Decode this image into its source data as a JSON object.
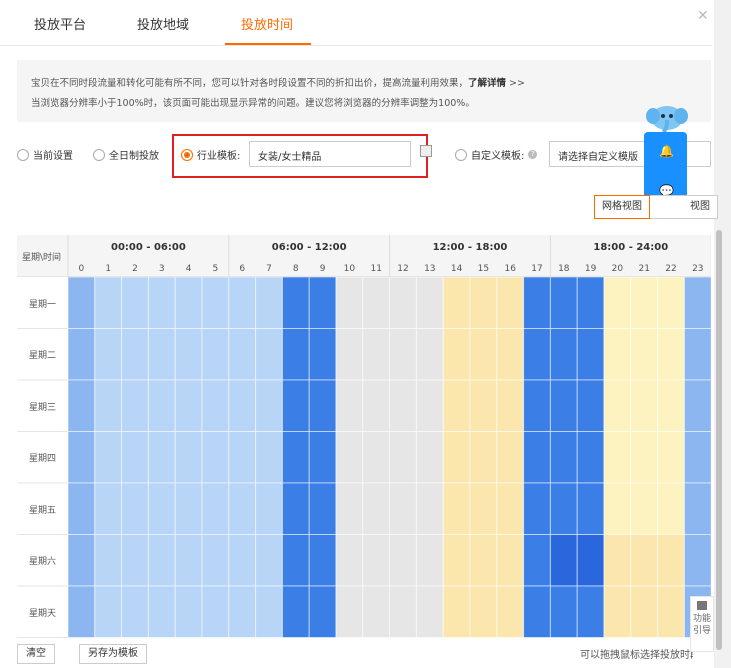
{
  "tabs": [
    {
      "label": "投放平台",
      "active": false
    },
    {
      "label": "投放地域",
      "active": false
    },
    {
      "label": "投放时间",
      "active": true
    }
  ],
  "notice": {
    "line1": "宝贝在不同时段流量和转化可能有所不同，您可以针对各时段设置不同的折扣出价，提高流量利用效果，",
    "link": "了解详情",
    "link_suffix": " >>",
    "line2": "当浏览器分辨率小于100%时，该页面可能出现显示异常的问题。建议您将浏览器的分辨率调整为100%。"
  },
  "options": {
    "current": "当前设置",
    "allday": "全日制投放",
    "industry": "行业模板:",
    "industry_value": "女装/女士精品",
    "custom": "自定义模板:",
    "custom_placeholder": "请选择自定义模版",
    "selected": "industry"
  },
  "views": {
    "grid": "网格视图",
    "other": "视图"
  },
  "grid": {
    "corner": "星期\\时间",
    "ranges": [
      "00:00 - 06:00",
      "06:00 - 12:00",
      "12:00 - 18:00",
      "18:00 - 24:00"
    ],
    "hours": [
      "0",
      "1",
      "2",
      "3",
      "4",
      "5",
      "6",
      "7",
      "8",
      "9",
      "10",
      "11",
      "12",
      "13",
      "14",
      "15",
      "16",
      "17",
      "18",
      "19",
      "20",
      "21",
      "22",
      "23"
    ],
    "days": [
      "星期一",
      "星期二",
      "星期三",
      "星期四",
      "星期五",
      "星期六",
      "星期天"
    ],
    "levels": [
      [
        2,
        1,
        1,
        1,
        1,
        1,
        1,
        1,
        3,
        3,
        0,
        0,
        0,
        0,
        4,
        4,
        4,
        3,
        3,
        3,
        5,
        5,
        5,
        2
      ],
      [
        2,
        1,
        1,
        1,
        1,
        1,
        1,
        1,
        3,
        3,
        0,
        0,
        0,
        0,
        4,
        4,
        4,
        3,
        3,
        3,
        5,
        5,
        5,
        2
      ],
      [
        2,
        1,
        1,
        1,
        1,
        1,
        1,
        1,
        3,
        3,
        0,
        0,
        0,
        0,
        4,
        4,
        4,
        3,
        3,
        3,
        5,
        5,
        5,
        2
      ],
      [
        2,
        1,
        1,
        1,
        1,
        1,
        1,
        1,
        3,
        3,
        0,
        0,
        0,
        0,
        4,
        4,
        4,
        3,
        3,
        3,
        5,
        5,
        5,
        2
      ],
      [
        2,
        1,
        1,
        1,
        1,
        1,
        1,
        1,
        3,
        3,
        0,
        0,
        0,
        0,
        4,
        4,
        4,
        3,
        3,
        3,
        5,
        5,
        5,
        2
      ],
      [
        2,
        1,
        1,
        1,
        1,
        1,
        1,
        1,
        3,
        3,
        0,
        0,
        0,
        0,
        4,
        4,
        4,
        3,
        6,
        6,
        4,
        4,
        4,
        2
      ],
      [
        2,
        1,
        1,
        1,
        1,
        1,
        1,
        1,
        3,
        3,
        0,
        0,
        0,
        0,
        4,
        4,
        4,
        3,
        3,
        3,
        4,
        4,
        4,
        2
      ]
    ],
    "level_colors": [
      "#e6e6e6",
      "#b8d4f7",
      "#8cb6f0",
      "#3a7ee6",
      "#fbe7ae",
      "#fdf3c0",
      "#2a66dc"
    ]
  },
  "bottom": {
    "clear": "清空",
    "save_template": "另存为模板",
    "hint": "可以拖拽鼠标选择投放时段"
  },
  "guide": {
    "label": "功能引导"
  }
}
